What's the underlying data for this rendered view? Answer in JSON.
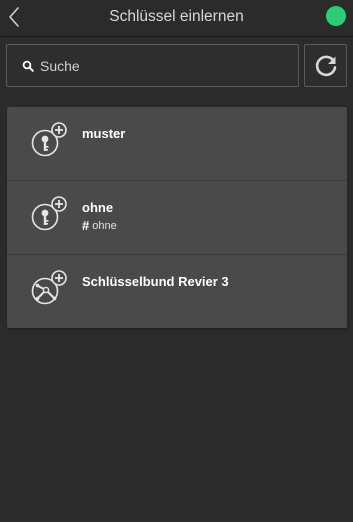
{
  "header": {
    "title": "Schlüssel einlernen",
    "back_icon": "chevron-left-icon",
    "status_color": "#2ecc71"
  },
  "search": {
    "placeholder": "Suche",
    "value": "",
    "icon": "search-icon"
  },
  "refresh": {
    "icon": "refresh-icon"
  },
  "items": [
    {
      "title": "muster",
      "icon": "key-add-icon",
      "tag": ""
    },
    {
      "title": "ohne",
      "icon": "key-add-icon",
      "tag": "ohne"
    },
    {
      "title": "Schlüsselbund Revier 3",
      "icon": "keyring-add-icon",
      "tag": ""
    }
  ]
}
